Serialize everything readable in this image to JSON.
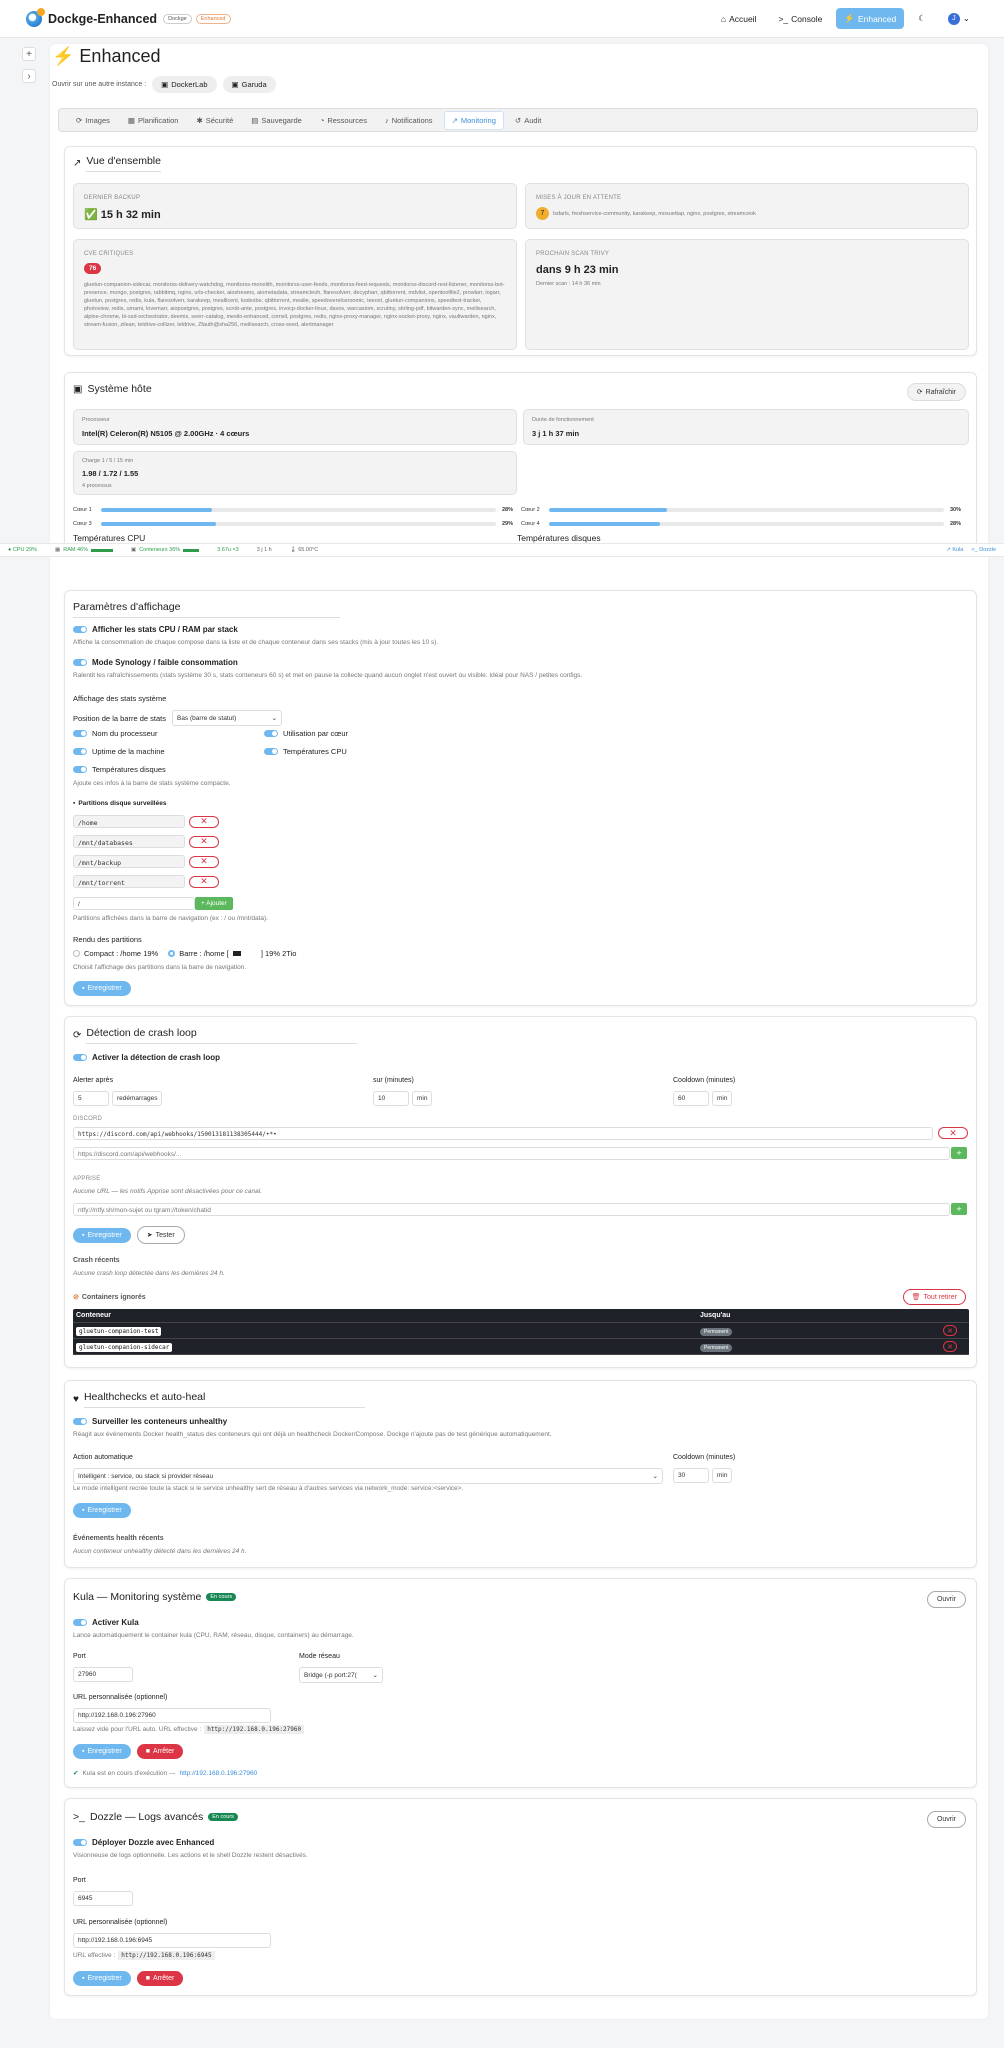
{
  "app": {
    "title": "Dockge-Enhanced",
    "badge1": "Dockge",
    "badge2": "Enhanced"
  },
  "nav": {
    "home": "Accueil",
    "console": "Console",
    "enhanced": "Enhanced",
    "avatar": "J"
  },
  "page": {
    "title": "Enhanced",
    "open_in": "Ouvrir sur une autre instance :",
    "instances": [
      "DockerLab",
      "Garuda"
    ]
  },
  "tabs": [
    "Images",
    "Planification",
    "Sécurité",
    "Sauvegarde",
    "Ressources",
    "Notifications",
    "Monitoring",
    "Audit"
  ],
  "overview": {
    "title": "Vue d'ensemble",
    "backup_label": "DERNIER BACKUP",
    "backup_value": "✅ 15 h 32 min",
    "updates_label": "MISES À JOUR EN ATTENTE",
    "updates_count": "7",
    "updates_list": "lsdarls, freshservice-community, karakeep, mosuettap, nginx, postgres, streamceok",
    "cve_label": "CVE CRITIQUES",
    "cve_count": "76",
    "cve_list": "gluetun-companion-sidecar, monitorss-delivery-watchdog, monitorss-monolith, monitorss-user-feeds, monitorss-feed-requests, monitorss-discord-rest-listener, monitorss-bot-presence, mongo, postgres, rabbitmq, nginx, urls-checker, aiostreams, aiometadata, streamcleoh, flaresolverr, decypharr, qbittorrent, mdvlist, opentoolfile2, prowlarr, logarr, gluetun, postgres, redis, kula, flaresolverr, karakeep, meallicent, kodexbe, qbittorrent, mealie, speedoverelosroomic, teeoxt, gluetun-companions, speedtest-tracker, photoview, redis, umami, lovemarr, aiopostgres, postgres, scrob-ante, postgres, invocp-docker-linux, davos, warcasiom, scrutiny, stirling-pdf, bitwarden-sync, meilisearch, alpine-chrome, bi-ssd-orchestrator, deemix, seerr-catalog, mesilo-enhanced, comsil, postgres, redis, nginx-proxy-manager, nginx-socket-proxy, nginx, vaultwarden, nginx, stream-fusion, zilean, teldrive-collizer, teldrive, Zfauth@sha256, meilisearch, cross-seed, alertmanager",
    "trivy_label": "PROCHAIN SCAN TRIVY",
    "trivy_value": "dans 9 h 23 min",
    "trivy_last": "Dernier scan : 14 h 36 min"
  },
  "host": {
    "title": "Système hôte",
    "refresh": "Rafraîchir",
    "cpu_label": "Processeur",
    "cpu_value": "Intel(R) Celeron(R) N5105 @ 2.00GHz · 4 cœurs",
    "uptime_label": "Durée de fonctionnement",
    "uptime_value": "3 j 1 h 37 min",
    "load_label": "Charge 1 / 5 / 15 min",
    "load_value": "1.98 / 1.72 / 1.55",
    "load_sub": "4 processus",
    "cores": [
      {
        "name": "Cœur 1",
        "pct": "28%",
        "v": 0.28
      },
      {
        "name": "Cœur 2",
        "pct": "30%",
        "v": 0.3
      },
      {
        "name": "Cœur 3",
        "pct": "29%",
        "v": 0.29
      },
      {
        "name": "Cœur 4",
        "pct": "28%",
        "v": 0.28
      }
    ],
    "temp_cpu": "Températures CPU",
    "temp_disk": "Températures disques"
  },
  "statusbar": {
    "cpu": "CPU 29%",
    "ram": "RAM 46%",
    "ram_extra": "Conteneurs 36%",
    "load": "3.67u ×3",
    "up": "3 j 1 h",
    "temp": "65.00°C",
    "kula": "Kula",
    "dozzle": "Dozzle"
  },
  "display": {
    "title": "Paramètres d'affichage",
    "t1": "Afficher les stats CPU / RAM par stack",
    "t1_desc": "Affiche la consommation de chaque compose dans la liste et de chaque conteneur dans ses stacks (mis à jour toutes les 10 s).",
    "t2": "Mode Synology / faible consommation",
    "t2_desc": "Ralentit les rafraîchissements (stats système 30 s, stats conteneurs 60 s) et met en pause la collecte quand aucun onglet n'est ouvert ou visible. Idéal pour NAS / petites configs.",
    "sys_label": "Affichage des stats système",
    "bar_pos_label": "Position de la barre de stats",
    "bar_pos_value": "Bas (barre de statut)",
    "opt_proc": "Nom du processeur",
    "opt_core": "Utilisation par cœur",
    "opt_uptime": "Uptime de la machine",
    "opt_tcpu": "Températures CPU",
    "opt_tdisk": "Températures disques",
    "opt_desc": "Ajoute ces infos à la barre de stats système compacte.",
    "parts_title": "Partitions disque surveillées",
    "partitions": [
      "/home",
      "/mnt/databases",
      "/mnt/backup",
      "/mnt/torrent"
    ],
    "part_placeholder": "/",
    "add": "+ Ajouter",
    "parts_desc": "Partitions affichées dans la barre de navigation (ex : / ou /mnt/data).",
    "render_label": "Rendu des partitions",
    "compact": "Compact : /home 19%",
    "bar_opt": "Barre : /home [",
    "bar_opt2": "] 19% 2Tio",
    "render_desc": "Choisit l'affichage des partitions dans la barre de navigation.",
    "save": "Enregistrer"
  },
  "crash": {
    "title": "Détection de crash loop",
    "enable": "Activer la détection de crash loop",
    "alert_label": "Alerter après",
    "alert_value": "5",
    "alert_unit": "redémarrages",
    "window_label": "sur (minutes)",
    "window_value": "10",
    "window_unit": "min",
    "cool_label": "Cooldown (minutes)",
    "cool_value": "60",
    "cool_unit": "min",
    "discord_label": "DISCORD",
    "discord_url": "https://discord.com/api/webhooks/150013181138305444/•*•",
    "discord_placeholder": "https://discord.com/api/webhooks/...",
    "apprise_label": "APPRISE",
    "apprise_desc": "Aucune URL — les notifs Apprise sont désactivées pour ce canal.",
    "apprise_placeholder": "ntfy://ntfy.sh/mon-sujet  ou  tgram://token/chatid",
    "save": "Enregistrer",
    "test": "Tester",
    "recent_title": "Crash récents",
    "recent_desc": "Aucune crash loop détectée dans les dernières 24 h.",
    "ignored_title": "Containers ignorés",
    "remove_all": "Tout retirer",
    "col_container": "Conteneur",
    "col_until": "Jusqu'au",
    "ignored": [
      {
        "name": "gluetun-companion-test",
        "until": "Permanent"
      },
      {
        "name": "gluetun-companion-sidecar",
        "until": "Permanent"
      }
    ]
  },
  "health": {
    "title": "Healthchecks et auto-heal",
    "enable": "Surveiller les conteneurs unhealthy",
    "desc": "Réagit aux événements Docker health_status des conteneurs qui ont déjà un healthcheck Docker/Compose. Dockge n'ajoute pas de test générique automatiquement.",
    "action_label": "Action automatique",
    "action_value": "Intelligent : service, ou stack si provider réseau",
    "cool_label": "Cooldown (minutes)",
    "cool_value": "30",
    "cool_unit": "min",
    "action_desc": "Le mode intelligent recrée toute la stack si le service unhealthy sert de réseau à d'autres services via network_mode: service:<service>.",
    "save": "Enregistrer",
    "events_title": "Événements health récents",
    "events_desc": "Aucun conteneur unhealthy détecté dans les dernières 24 h."
  },
  "kula": {
    "title": "Kula — Monitoring système",
    "status": "En cours",
    "open": "Ouvrir",
    "enable": "Activer Kula",
    "desc": "Lance automatiquement le container kula (CPU, RAM, réseau, disque, containers) au démarrage.",
    "port_label": "Port",
    "port_value": "27960",
    "mode_label": "Mode réseau",
    "mode_value": "Bridge (-p port:27(",
    "url_label": "URL personnalisée (optionnel)",
    "url_value": "http://192.168.0.196:27960",
    "url_hint": "Laissez vide pour l'URL auto. URL effective :",
    "url_eff": "http://192.168.0.196:27960",
    "save": "Enregistrer",
    "stop": "Arrêter",
    "running": "Kula est en cours d'exécution —",
    "running_link": "http://192.168.0.196:27960"
  },
  "dozzle": {
    "title": "Dozzle — Logs avancés",
    "status": "En cours",
    "open": "Ouvrir",
    "enable": "Déployer Dozzle avec Enhanced",
    "desc": "Visionneuse de logs optionnelle. Les actions et le shell Dozzle restent désactivés.",
    "port_label": "Port",
    "port_value": "6945",
    "url_label": "URL personnalisée (optionnel)",
    "url_value": "http://192.168.0.196:6945",
    "url_eff_label": "URL effective :",
    "url_eff": "http://192.168.0.196:6945",
    "save": "Enregistrer",
    "stop": "Arrêter"
  }
}
